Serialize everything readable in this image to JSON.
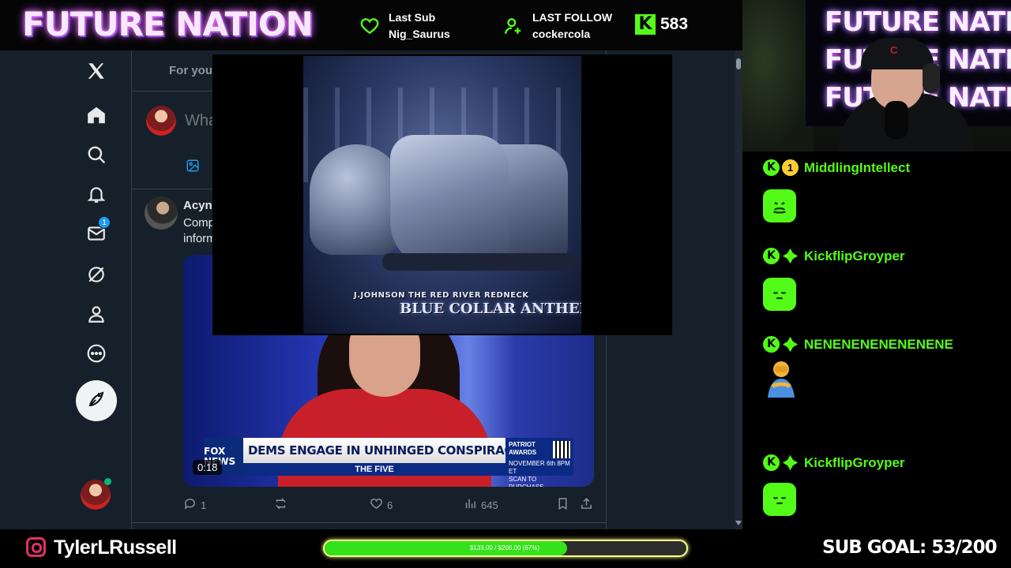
{
  "stream": {
    "brand": "FUTURE NATION",
    "last_sub": {
      "label": "Last Sub",
      "name": "Nig_Saurus"
    },
    "last_follow": {
      "label": "LAST FOLLOW",
      "name": "cockercola"
    },
    "kick_followers": "583",
    "instagram_handle": "TylerLRussell",
    "sub_goal": {
      "text": "SUB GOAL: 53/200",
      "progress_text": "$133.00 / $200.00 (67%)",
      "progress_fraction": 0.67
    },
    "accent_color": "#53fc18"
  },
  "x": {
    "tab_for_you": "For you",
    "composer_placeholder": "Wha",
    "mail_badge": "1",
    "tweet": {
      "author": "Acyn",
      "text_line1": "Comp",
      "text_line2": "inform",
      "video": {
        "duration": "0:18",
        "chyron_network": "FOX NEWS",
        "chyron_headline": "DEMS ENGAGE IN UNHINGED CONSPIRACIES ABOUT TRUMP",
        "chyron_show": "THE FIVE",
        "promo_title": "PATRIOT AWARDS",
        "promo_date": "NOVEMBER 6th 8PM ET",
        "promo_cta": "SCAN TO PURCHASE"
      },
      "replies": "1",
      "likes": "6",
      "views": "645"
    }
  },
  "album": {
    "artist": "J.JOHNSON THE RED RIVER REDNECK",
    "title": "BLUE COLLAR ANTHEM"
  },
  "webcam": {
    "sign_text": "FUTURE NATION"
  },
  "chat": {
    "messages": [
      {
        "user": "MiddlingIntellect",
        "badge": "1",
        "emote": "sick-face-emote"
      },
      {
        "user": "KickflipGroyper",
        "emote": "sleepy-face-emote"
      },
      {
        "user": "NENENENENENENENE",
        "emote": "person-bowing-emote"
      },
      {
        "user": "KickflipGroyper",
        "emote": "sleepy-face-emote"
      }
    ]
  }
}
